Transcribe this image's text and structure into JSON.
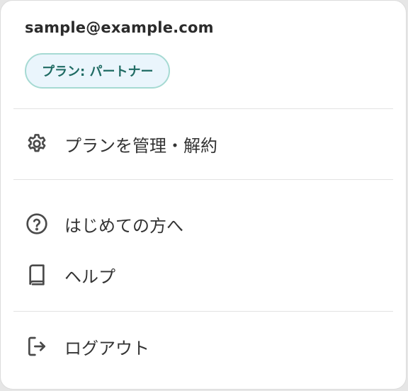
{
  "account": {
    "email": "sample@example.com",
    "plan_badge": "プラン: パートナー"
  },
  "menu": {
    "manage_plan": {
      "label": "プランを管理・解約",
      "icon": "gear-icon"
    },
    "getting_started": {
      "label": "はじめての方へ",
      "icon": "question-circle-icon"
    },
    "help": {
      "label": "ヘルプ",
      "icon": "book-icon"
    },
    "logout": {
      "label": "ログアウト",
      "icon": "logout-icon"
    }
  },
  "colors": {
    "badge_bg": "#eaf5fc",
    "badge_border": "#a6dad3",
    "badge_text": "#1f6b63",
    "divider": "#e2e2e2"
  }
}
